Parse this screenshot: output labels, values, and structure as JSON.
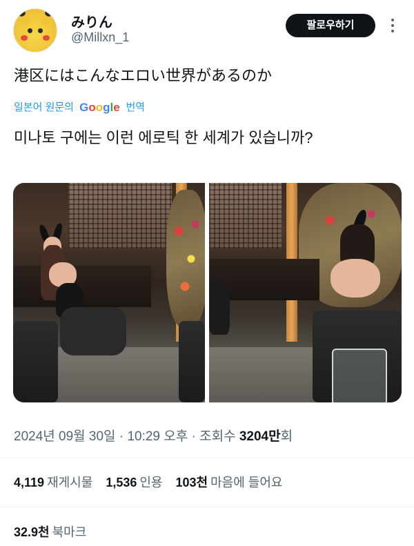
{
  "author": {
    "display_name": "みりん",
    "handle": "@Millxn_1",
    "avatar_icon": "pikachu-avatar-icon"
  },
  "follow_button": "팔로우하기",
  "more_icon": "more-options-icon",
  "tweet": {
    "text": "港区にはこんなエロい世界があるのか",
    "translate": {
      "prefix": "일본어 원문의",
      "brand": "Google",
      "suffix": "번역"
    },
    "translated_text": "미나토 구에는 이런 에로틱 한 세계가 있습니까?"
  },
  "timestamp": {
    "date": "2024년 09월 30일",
    "sep1": "·",
    "time": "10:29 오후",
    "sep2": "·",
    "views_label": "조회수",
    "views_value": "3204만",
    "views_suffix": "회"
  },
  "stats": {
    "reposts_value": "4,119",
    "reposts_label": "재게시물",
    "quotes_value": "1,536",
    "quotes_label": "인용",
    "likes_value": "103천",
    "likes_label": "마음에 들어요"
  },
  "bookmarks": {
    "value": "32.9천",
    "label": "북마크"
  },
  "colors": {
    "link_blue": "#1d9bf0",
    "secondary_text": "#536471",
    "primary_text": "#0f1419"
  }
}
